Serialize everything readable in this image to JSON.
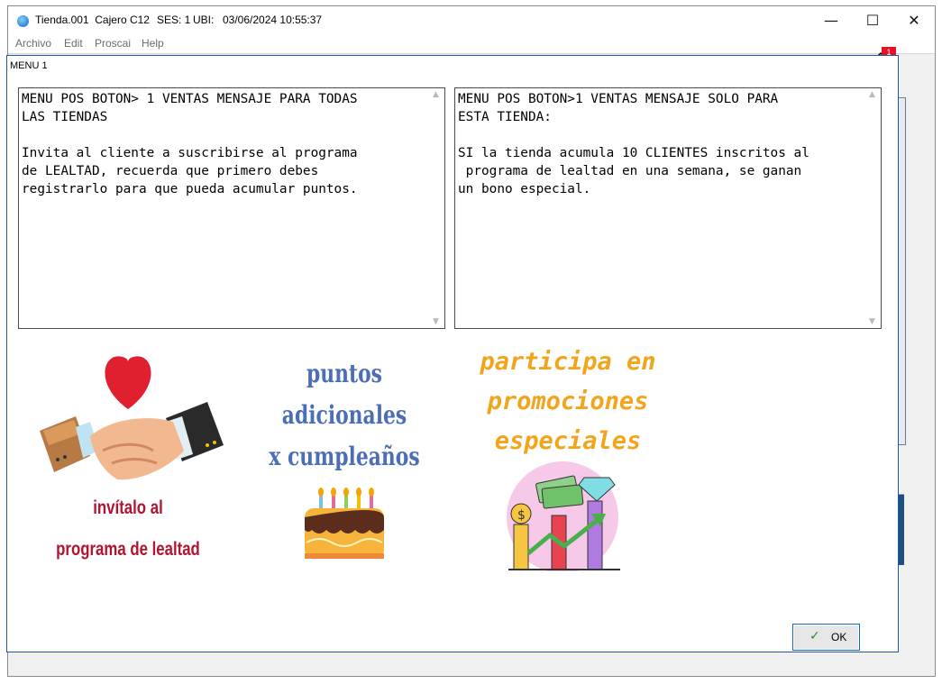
{
  "window": {
    "title": "Tienda.001  Cajero C12",
    "session": "SES: 1",
    "location_label": "UBI:",
    "datetime": "03/06/2024 10:55:37",
    "minimize": "—",
    "maximize": "☐",
    "close": "✕"
  },
  "menubar": {
    "items": [
      {
        "label": "Archivo"
      },
      {
        "label": "Edit"
      },
      {
        "label": "Proscai"
      },
      {
        "label": "Help"
      }
    ]
  },
  "background": {
    "notification_count": "1"
  },
  "dialog": {
    "title": "MENU 1",
    "message_all_stores": "MENU POS BOTON> 1 VENTAS MENSAJE PARA TODAS\nLAS TIENDAS\n\nInvita al cliente a suscribirse al programa\nde LEALTAD, recuerda que primero debes\nregistrarlo para que pueda acumular puntos.",
    "message_this_store": "MENU POS BOTON>1 VENTAS MENSAJE SOLO PARA\nESTA TIENDA:\n\nSI la tienda acumula 10 CLIENTES inscritos al\n programa de lealtad en una semana, se ganan\nun bono especial.",
    "promo_1_line1": "invítalo al",
    "promo_1_line2": "programa de lealtad",
    "promo_2_line1": "puntos",
    "promo_2_line2": "adicionales",
    "promo_2_line3": "x cumpleaños",
    "promo_3_line1": "participa en",
    "promo_3_line2": "promociones",
    "promo_3_line3": "especiales",
    "ok_label": "OK"
  },
  "colors": {
    "accent_blue": "#1b5aa6",
    "caption_red": "#b5122f",
    "caption_blue": "#4c6eb6",
    "caption_orange": "#f2a51c",
    "ok_check": "#2b8a2b"
  },
  "icons": {
    "app": "globe-icon",
    "heart": "heart-icon",
    "handshake": "handshake-icon",
    "cake": "birthday-cake-icon",
    "growth": "growth-chart-icon",
    "ok": "checkmark-icon"
  }
}
